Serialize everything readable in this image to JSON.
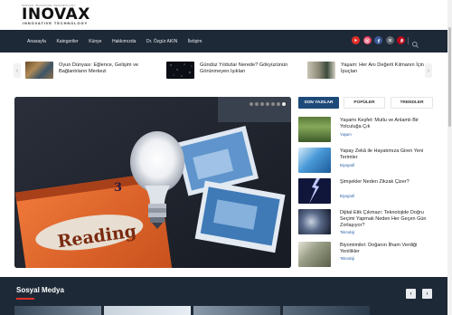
{
  "site": {
    "logo_tiny": "INOVAX INOVATIVE TECHNOLOGY",
    "logo_main": "INOVAX",
    "logo_sub": "INNOVATIVE TECHNOLOGY"
  },
  "nav": {
    "items": [
      "Anasayfa",
      "Kategoriler",
      "Künye",
      "Hakkımızda",
      "Dr. Özgür AKIN",
      "İletişim"
    ],
    "social_icons": [
      "youtube-icon",
      "instagram-icon",
      "facebook-icon",
      "x-icon",
      "pinterest-icon"
    ],
    "search_icon": "search-icon"
  },
  "ticker": [
    {
      "title": "Oyun Dünyası: Eğlence, Gelişim ve Bağlantıların Merkezi"
    },
    {
      "title": "Gündüz Yıldızlar Nerede? Gökyüzünün Görünmeyen Işıkları"
    },
    {
      "title": "Yaşam: Her Anı Değerli Kılmanın İçin İpuçları"
    }
  ],
  "tabs": [
    "SON YAZILAR",
    "POPÜLER",
    "TRENDLER"
  ],
  "side_list": [
    {
      "title": "Yaşamı Keşfet: Mutlu ve Anlamlı Bir Yolculuğa Çık",
      "category": "Yaşam"
    },
    {
      "title": "Yapay Zekâ ile Hayatımıza Giren Yeni Terimler",
      "category": "Biyografi"
    },
    {
      "title": "Şimşekler Neden Zikzak Çizer?",
      "category": "Biyografi"
    },
    {
      "title": "Dijital Etik Çıkmazı: Teknolojide Doğru Seçimi Yapmak Neden Her Geçen Gün Zorlaşıyor?",
      "category": "Teknoloji"
    },
    {
      "title": "Biyomimikri: Doğanın İlham Verdiği Yenilikler",
      "category": "Teknoloji"
    }
  ],
  "hero": {
    "slide_count": 7,
    "active_slide": 1,
    "book_title": "Reading",
    "book_number": "3"
  },
  "band": {
    "title": "Sosyal Medya"
  },
  "colors": {
    "nav_bg": "#1e2937",
    "accent": "#1e4a7a",
    "link": "#2a5ea8"
  }
}
